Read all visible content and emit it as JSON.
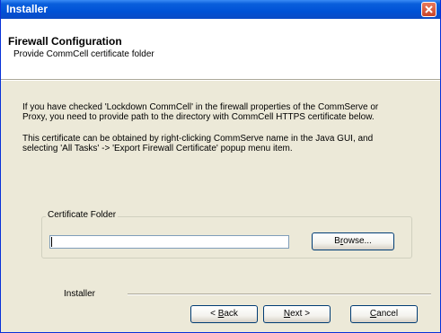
{
  "window": {
    "title": "Installer"
  },
  "header": {
    "title": "Firewall Configuration",
    "subtitle": "Provide CommCell certificate folder"
  },
  "body": {
    "paragraph1_line1": "If you have checked 'Lockdown CommCell' in the firewall properties of the CommServe or",
    "paragraph1_line2": "Proxy, you need to provide path to the directory with CommCell HTTPS certificate below.",
    "paragraph2_line1": "This certificate can be obtained by right-clicking CommServe name in the Java GUI, and",
    "paragraph2_line2": "selecting 'All Tasks' -> 'Export Firewall Certificate' popup menu item."
  },
  "certificate_group": {
    "label": "Certificate Folder",
    "input_value": "",
    "browse": {
      "pre": "B",
      "mnemonic": "r",
      "post": "owse..."
    }
  },
  "footer": {
    "label": "Installer",
    "back": {
      "pre": "< ",
      "mnemonic": "B",
      "post": "ack"
    },
    "next": {
      "mnemonic": "N",
      "post": "ext >"
    },
    "cancel": {
      "mnemonic": "C",
      "post": "ancel"
    }
  },
  "colors": {
    "titlebar": "#0a5fdc",
    "dialog_bg": "#ece9d8",
    "close_button": "#c9452a"
  }
}
